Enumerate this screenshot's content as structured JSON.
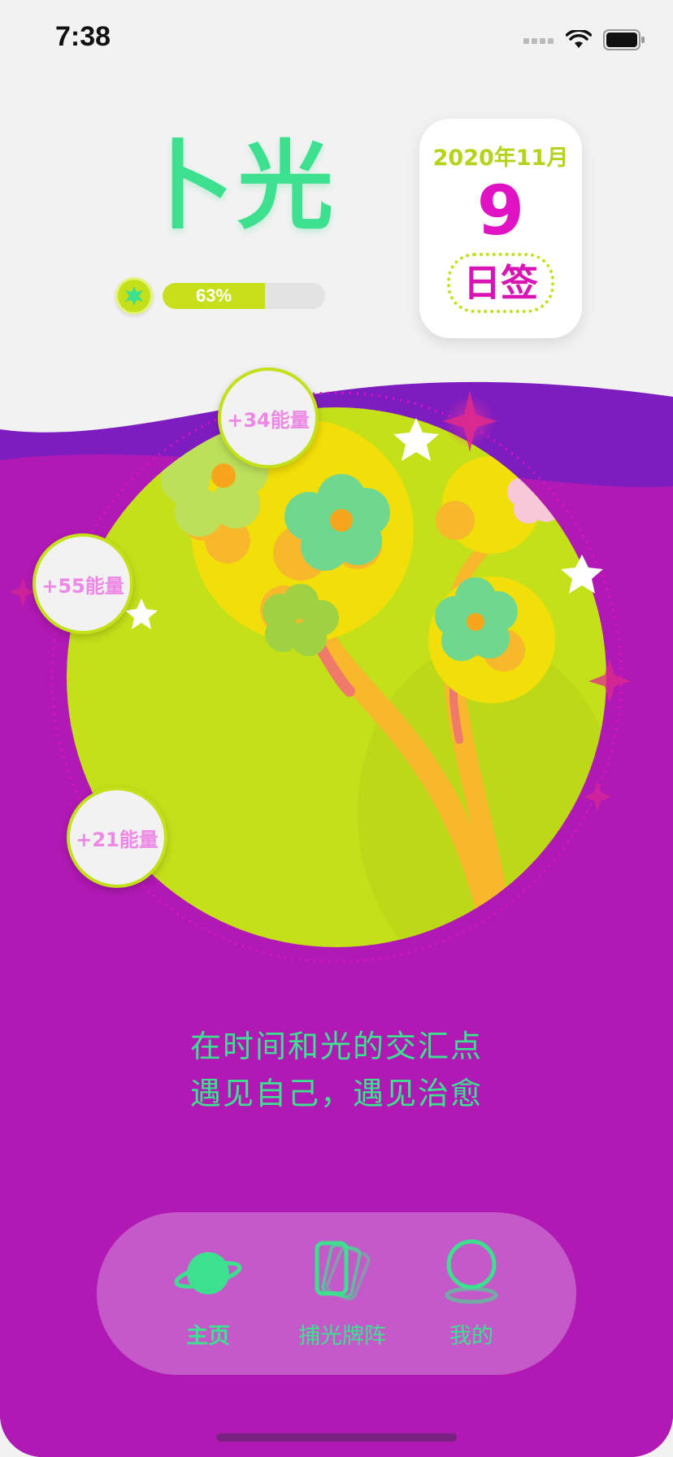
{
  "status_bar": {
    "time": "7:38"
  },
  "header": {
    "app_title": "卜光",
    "energy_progress": {
      "percent": 63,
      "label": "63%"
    }
  },
  "date_card": {
    "year_month": "2020年11月",
    "day": "9",
    "sign_label": "日签"
  },
  "energy_bubbles": [
    {
      "label": "+34能量"
    },
    {
      "label": "+55能量"
    },
    {
      "label": "+21能量"
    }
  ],
  "slogan": {
    "line1": "在时间和光的交汇点",
    "line2": "遇见自己，遇见治愈"
  },
  "tabbar": {
    "items": [
      {
        "label": "主页",
        "icon": "planet-icon",
        "active": true
      },
      {
        "label": "捕光牌阵",
        "icon": "cards-icon",
        "active": false
      },
      {
        "label": "我的",
        "icon": "profile-icon",
        "active": false
      }
    ]
  },
  "colors": {
    "brand_green": "#3de08f",
    "magenta_bg": "#b019b4",
    "purple_wave": "#7d1cbf",
    "lime": "#c3e019",
    "accent_pink": "#e012c4",
    "flower_yellow": "#f2de08",
    "branch_orange": "#f7b82c"
  }
}
